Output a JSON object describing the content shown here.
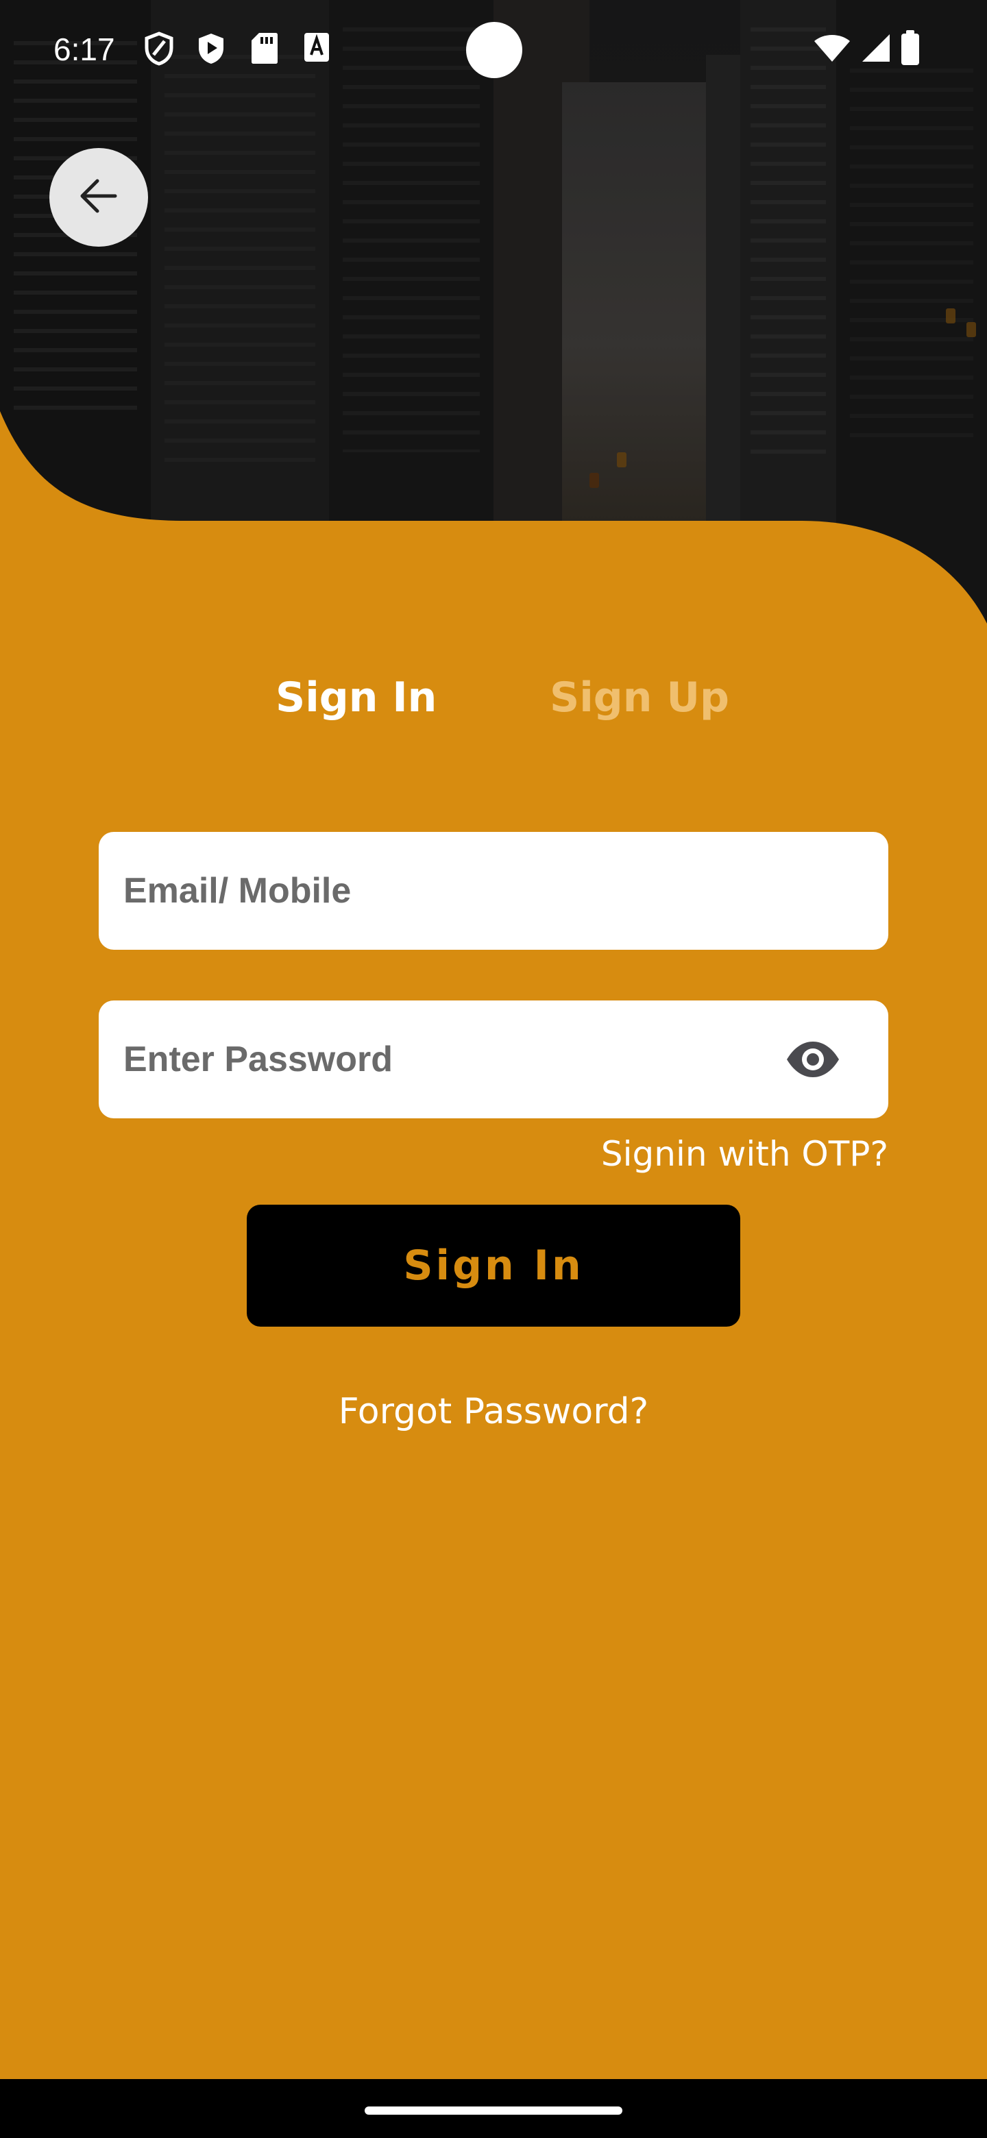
{
  "status_bar": {
    "time": "6:17",
    "left_icons": [
      "shield-outline-icon",
      "shield-play-icon",
      "sd-card-icon",
      "font-a-icon"
    ],
    "right_icons": [
      "wifi-icon",
      "signal-icon",
      "battery-icon"
    ]
  },
  "back_button": {
    "icon": "arrow-left-icon"
  },
  "tabs": {
    "signin_label": "Sign In",
    "signup_label": "Sign Up",
    "active": "signin"
  },
  "form": {
    "email_placeholder": "Email/ Mobile",
    "email_value": "",
    "password_placeholder": "Enter Password",
    "password_value": "",
    "password_toggle_icon": "eye-icon",
    "otp_link": "Signin with OTP?",
    "submit_label": "Sign In",
    "forgot_link": "Forgot Password?"
  },
  "colors": {
    "accent": "#d78c10",
    "inactive_tab": "#f0bf6e",
    "button": "#000000",
    "field_bg": "#ffffff"
  }
}
